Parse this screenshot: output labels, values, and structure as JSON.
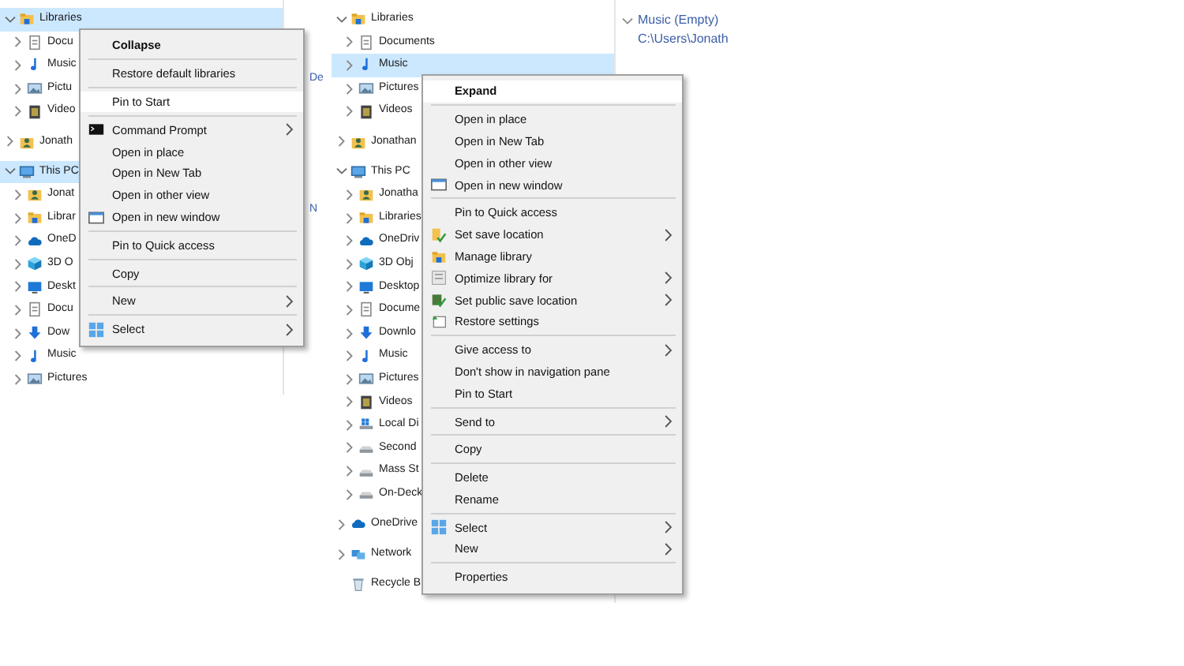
{
  "left_pane": {
    "tree": [
      {
        "label": "Libraries",
        "kind": "library",
        "expanded": true,
        "selected": true,
        "children": [
          {
            "label": "Docu",
            "kind": "document",
            "expanded": false,
            "selected": false
          },
          {
            "label": "Music",
            "kind": "music",
            "expanded": false,
            "selected": false
          },
          {
            "label": "Pictu",
            "kind": "pictures",
            "expanded": false,
            "selected": false
          },
          {
            "label": "Video",
            "kind": "videos",
            "expanded": false,
            "selected": false
          }
        ]
      },
      {
        "label": "Jonath",
        "kind": "user",
        "expanded": false,
        "selected": false
      },
      {
        "label": "This PC",
        "kind": "pc",
        "expanded": true,
        "selected": true,
        "children": [
          {
            "label": "Jonat",
            "kind": "user",
            "expanded": false,
            "selected": false
          },
          {
            "label": "Librar",
            "kind": "library",
            "expanded": false,
            "selected": false
          },
          {
            "label": "OneD",
            "kind": "cloud",
            "expanded": false,
            "selected": false
          },
          {
            "label": "3D O",
            "kind": "cube",
            "expanded": false,
            "selected": false
          },
          {
            "label": "Deskt",
            "kind": "desktop",
            "expanded": false,
            "selected": false
          },
          {
            "label": "Docu",
            "kind": "document",
            "expanded": false,
            "selected": false
          },
          {
            "label": "Dow",
            "kind": "download",
            "expanded": false,
            "selected": false
          },
          {
            "label": "Music",
            "kind": "music",
            "expanded": false,
            "selected": false
          },
          {
            "label": "Pictures",
            "kind": "pictures",
            "expanded": false,
            "selected": false
          }
        ]
      }
    ],
    "details": [
      "De",
      "N"
    ],
    "context_menu": [
      {
        "kind": "plain",
        "label": "Collapse",
        "default": true,
        "selected": false
      },
      {
        "kind": "separator"
      },
      {
        "kind": "plain",
        "label": "Restore default libraries",
        "selected": false
      },
      {
        "kind": "separator"
      },
      {
        "kind": "plain",
        "label": "Pin to Start",
        "selected": true
      },
      {
        "kind": "separator"
      },
      {
        "kind": "cmd",
        "label": "Command Prompt",
        "submenu": true,
        "selected": false
      },
      {
        "kind": "plain",
        "label": "Open in place",
        "selected": false
      },
      {
        "kind": "plain",
        "label": "Open in New Tab",
        "selected": false
      },
      {
        "kind": "plain",
        "label": "Open in other view",
        "selected": false
      },
      {
        "kind": "window",
        "label": "Open in new window",
        "selected": false
      },
      {
        "kind": "separator"
      },
      {
        "kind": "plain",
        "label": "Pin to Quick access",
        "selected": false
      },
      {
        "kind": "separator"
      },
      {
        "kind": "plain",
        "label": "Copy",
        "selected": false
      },
      {
        "kind": "separator"
      },
      {
        "kind": "plain",
        "label": "New",
        "submenu": true,
        "selected": false
      },
      {
        "kind": "separator"
      },
      {
        "kind": "grid",
        "label": "Select",
        "submenu": true,
        "selected": false
      }
    ]
  },
  "middle_pane": {
    "tree": [
      {
        "label": "Libraries",
        "kind": "library",
        "expanded": true,
        "selected": false,
        "children": [
          {
            "label": "Documents",
            "kind": "document",
            "expanded": false,
            "selected": false
          },
          {
            "label": "Music",
            "kind": "music",
            "expanded": false,
            "selected": true
          },
          {
            "label": "Pictures",
            "kind": "pictures",
            "expanded": false,
            "selected": false
          },
          {
            "label": "Videos",
            "kind": "videos",
            "expanded": false,
            "selected": false
          }
        ]
      },
      {
        "label": "Jonathan",
        "kind": "user",
        "expanded": false,
        "selected": false
      },
      {
        "label": "This PC",
        "kind": "pc",
        "expanded": true,
        "selected": false,
        "children": [
          {
            "label": "Jonatha",
            "kind": "user",
            "expanded": false,
            "selected": false
          },
          {
            "label": "Libraries",
            "kind": "library",
            "expanded": false,
            "selected": false
          },
          {
            "label": "OneDriv",
            "kind": "cloud",
            "expanded": false,
            "selected": false
          },
          {
            "label": "3D Obj",
            "kind": "cube",
            "expanded": false,
            "selected": false
          },
          {
            "label": "Desktop",
            "kind": "desktop",
            "expanded": false,
            "selected": false
          },
          {
            "label": "Docume",
            "kind": "document",
            "expanded": false,
            "selected": false
          },
          {
            "label": "Downlo",
            "kind": "download",
            "expanded": false,
            "selected": false
          },
          {
            "label": "Music",
            "kind": "music",
            "expanded": false,
            "selected": false
          },
          {
            "label": "Pictures",
            "kind": "pictures",
            "expanded": false,
            "selected": false
          },
          {
            "label": "Videos",
            "kind": "videos",
            "expanded": false,
            "selected": false
          },
          {
            "label": "Local Di",
            "kind": "drive-windows",
            "expanded": false,
            "selected": false
          },
          {
            "label": "Second",
            "kind": "drive",
            "expanded": false,
            "selected": false
          },
          {
            "label": "Mass St",
            "kind": "drive",
            "expanded": false,
            "selected": false
          },
          {
            "label": "On-Deck",
            "kind": "drive",
            "expanded": false,
            "selected": false
          }
        ]
      },
      {
        "label": "OneDrive",
        "kind": "cloud",
        "expanded": false,
        "selected": false
      },
      {
        "label": "Network",
        "kind": "network",
        "expanded": false,
        "selected": false
      },
      {
        "label": "Recycle B",
        "kind": "recycle",
        "expandable": false,
        "expanded": false,
        "selected": false
      }
    ],
    "context_menu": [
      {
        "kind": "plain",
        "label": "Expand",
        "default": true,
        "selected": true
      },
      {
        "kind": "separator"
      },
      {
        "kind": "plain",
        "label": "Open in place",
        "selected": false
      },
      {
        "kind": "plain",
        "label": "Open in New Tab",
        "selected": false
      },
      {
        "kind": "plain",
        "label": "Open in other view",
        "selected": false
      },
      {
        "kind": "window",
        "label": "Open in new window",
        "selected": false
      },
      {
        "kind": "separator"
      },
      {
        "kind": "plain",
        "label": "Pin to Quick access",
        "selected": false
      },
      {
        "kind": "folder-check",
        "label": "Set save location",
        "submenu": true,
        "selected": false
      },
      {
        "kind": "library",
        "label": "Manage library",
        "selected": false
      },
      {
        "kind": "optimize",
        "label": "Optimize library for",
        "submenu": true,
        "selected": false
      },
      {
        "kind": "public",
        "label": "Set public save location",
        "submenu": true,
        "selected": false
      },
      {
        "kind": "restore",
        "label": "Restore settings",
        "selected": false
      },
      {
        "kind": "separator"
      },
      {
        "kind": "plain",
        "label": "Give access to",
        "submenu": true,
        "selected": false
      },
      {
        "kind": "plain",
        "label": "Don't show in navigation pane",
        "selected": false
      },
      {
        "kind": "plain",
        "label": "Pin to Start",
        "selected": false
      },
      {
        "kind": "separator"
      },
      {
        "kind": "plain",
        "label": "Send to",
        "submenu": true,
        "selected": false
      },
      {
        "kind": "separator"
      },
      {
        "kind": "plain",
        "label": "Copy",
        "selected": false
      },
      {
        "kind": "separator"
      },
      {
        "kind": "plain",
        "label": "Delete",
        "selected": false
      },
      {
        "kind": "plain",
        "label": "Rename",
        "selected": false
      },
      {
        "kind": "separator"
      },
      {
        "kind": "grid",
        "label": "Select",
        "submenu": true,
        "selected": false
      },
      {
        "kind": "plain",
        "label": "New",
        "submenu": true,
        "selected": false
      },
      {
        "kind": "separator"
      },
      {
        "kind": "plain",
        "label": "Properties",
        "selected": false
      }
    ]
  },
  "right_pane": {
    "group": {
      "label": "Music (Empty)",
      "expanded": true
    },
    "path": "C:\\Users\\Jonath"
  }
}
